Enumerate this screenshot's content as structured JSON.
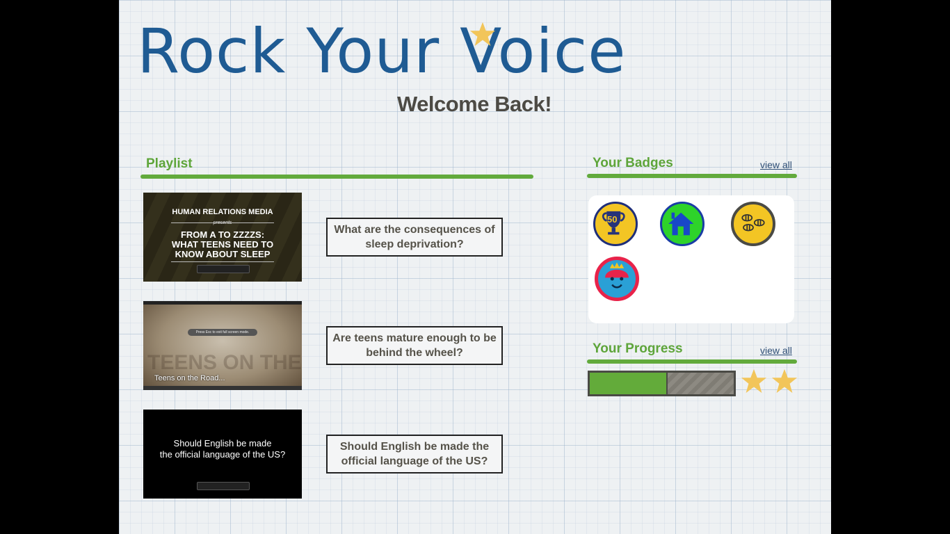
{
  "app": {
    "logo_text": "Rock Your Voice",
    "welcome": "Welcome Back!"
  },
  "playlist": {
    "title": "Playlist",
    "items": [
      {
        "thumb_lines": [
          "HUMAN RELATIONS MEDIA",
          "presents",
          "FROM A TO ZZZZS:",
          "WHAT TEENS NEED TO",
          "KNOW ABOUT SLEEP"
        ],
        "question": "What are the consequences of sleep deprivation?"
      },
      {
        "thumb_overlay": "Press Esc to exit full screen mode.",
        "thumb_caption": "Teens on the Road...",
        "thumb_bg_text": "TEENS ON THE ROAD",
        "question": "Are teens mature enough to be behind the wheel?"
      },
      {
        "thumb_lines": [
          "Should English be made",
          "the official language of the US?"
        ],
        "question": "Should English be made the official language of the US?"
      }
    ]
  },
  "badges": {
    "title": "Your Badges",
    "view_all": "view all",
    "items": [
      {
        "icon": "trophy-50-badge-icon",
        "label": "50"
      },
      {
        "icon": "house-badge-icon"
      },
      {
        "icon": "bees-badge-icon"
      },
      {
        "icon": "king-face-badge-icon"
      }
    ]
  },
  "progress": {
    "title": "Your Progress",
    "view_all": "view all",
    "fraction": 0.53,
    "stars": 2
  },
  "colors": {
    "brand_blue": "#1f5b93",
    "accent_green": "#62aa3c",
    "star_gold": "#f2c55a"
  }
}
